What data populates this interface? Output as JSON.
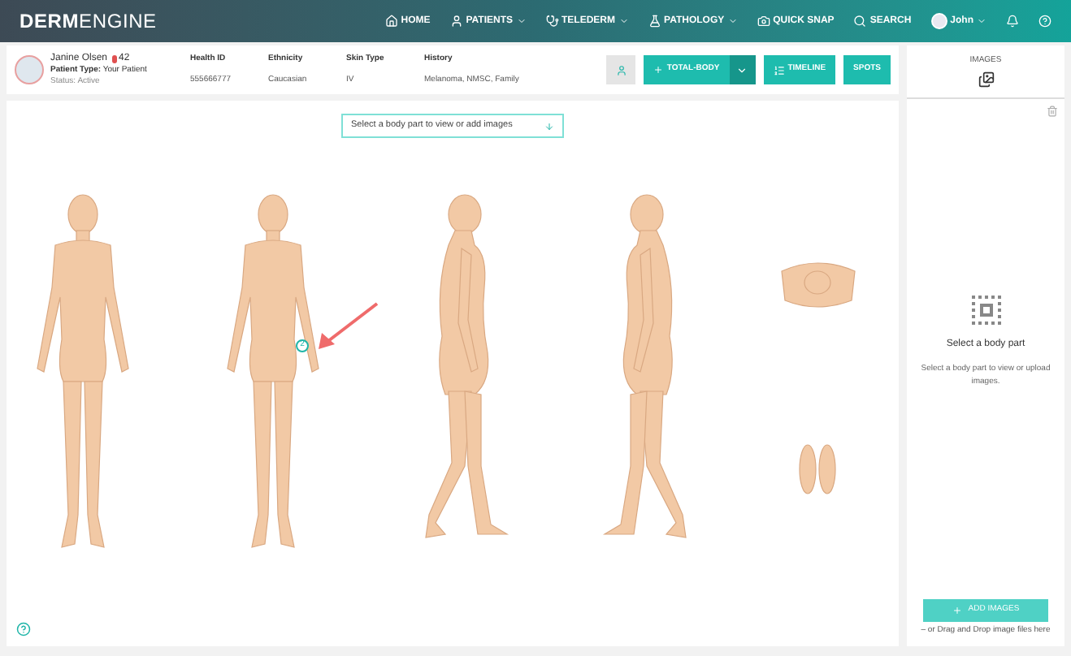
{
  "nav": {
    "logo_bold": "DERM",
    "logo_light": "ENGINE",
    "items": [
      {
        "label": "HOME",
        "kind": "home",
        "dropdown": false
      },
      {
        "label": "PATIENTS",
        "kind": "patients",
        "dropdown": true
      },
      {
        "label": "TELEDERM",
        "kind": "telederm",
        "dropdown": true
      },
      {
        "label": "PATHOLOGY",
        "kind": "pathology",
        "dropdown": true
      },
      {
        "label": "QUICK SNAP",
        "kind": "snap",
        "dropdown": false
      },
      {
        "label": "SEARCH",
        "kind": "search",
        "dropdown": false
      }
    ],
    "user": "John"
  },
  "patient": {
    "name": "Janine Olsen",
    "spots": "42",
    "type_label": "Patient Type:",
    "type_value": "Your Patient",
    "status_label": "Status:",
    "status_value": "Active",
    "fields": [
      {
        "label": "Health ID",
        "value": "555666777"
      },
      {
        "label": "Ethnicity",
        "value": "Caucasian"
      },
      {
        "label": "Skin Type",
        "value": "IV"
      },
      {
        "label": "History",
        "value": "Melanoma, NMSC, Family"
      }
    ]
  },
  "toolbar": {
    "view_button": "TOTAL-BODY",
    "timeline": "TIMELINE",
    "spots": "SPOTS"
  },
  "body_map": {
    "prompt": "Select a body part to view or add images",
    "spot_marker": "2"
  },
  "images_panel": {
    "title": "IMAGES",
    "heading": "Select a body part",
    "hint": "Select a body part to view or upload images.",
    "add_button": "ADD IMAGES",
    "drop_hint": "– or Drag and Drop image files here"
  }
}
